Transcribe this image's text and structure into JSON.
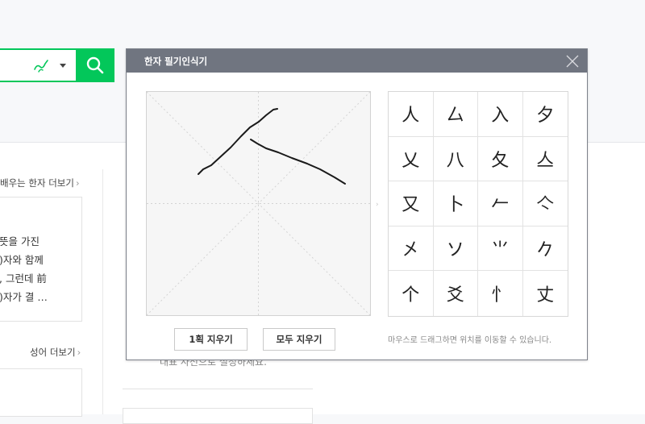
{
  "page": {
    "more_links": {
      "learn_hanja": "배우는 한자 더보기",
      "idiom": "성어 더보기",
      "chevron": "›"
    },
    "hanja_card": {
      "lines": [
        "뜻을 가진",
        ")자와 함께",
        ", 그런데 前",
        ")자가 결 …"
      ]
    },
    "partial_text_under_popup": "대표 사전으로 설정하세요."
  },
  "popup": {
    "title": "한자 필기인식기",
    "candidates": [
      "人",
      "厶",
      "入",
      "夕",
      "乂",
      "八",
      "夂",
      "亼",
      "又",
      "卜",
      "𠂉",
      "亽",
      "㐅",
      "ソ",
      "⺌",
      "𠂊",
      "个",
      "爻",
      "忄",
      "丈"
    ],
    "undo_button": "1획 지우기",
    "clear_button": "모두 지우기",
    "drag_hint": "마우스로 드래그하면 위치를 이동할 수 있습니다.",
    "arrow_hint": "›"
  },
  "colors": {
    "brand_green": "#03c75a",
    "popup_header": "#707580"
  },
  "icons": [
    "handwriting-pen-icon",
    "dropdown-caret-icon",
    "search-icon",
    "close-icon",
    "chevron-right-icon"
  ]
}
